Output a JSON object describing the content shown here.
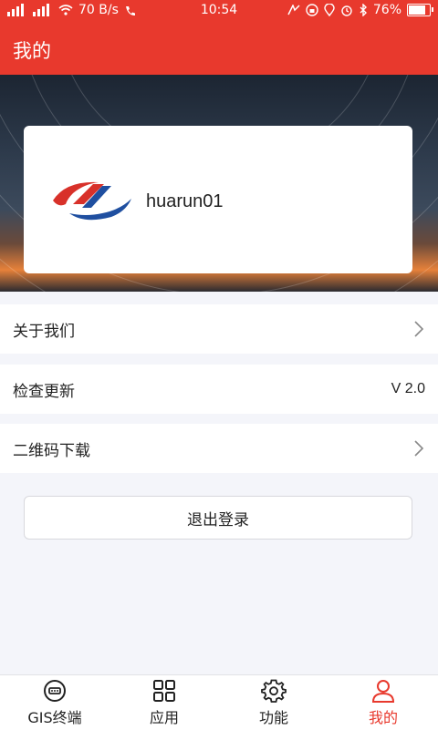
{
  "status_bar": {
    "net_left": "2G",
    "net_right": "4G",
    "speed": "70 B/s",
    "hd": "HD",
    "time": "10:54",
    "battery": "76%",
    "battery_level": 0.76
  },
  "header": {
    "title": "我的"
  },
  "profile": {
    "username": "huarun01"
  },
  "menu": {
    "about": "关于我们",
    "check_update": "检查更新",
    "version": "V 2.0",
    "qr_download": "二维码下载"
  },
  "logout_label": "退出登录",
  "nav": {
    "items": [
      {
        "label": "GIS终端",
        "icon": "gis-terminal-icon",
        "active": false
      },
      {
        "label": "应用",
        "icon": "apps-grid-icon",
        "active": false
      },
      {
        "label": "功能",
        "icon": "gear-icon",
        "active": false
      },
      {
        "label": "我的",
        "icon": "user-icon",
        "active": true
      }
    ]
  },
  "colors": {
    "accent": "#e8392d",
    "logo_red": "#d8312a",
    "logo_blue": "#1f4fa0"
  }
}
